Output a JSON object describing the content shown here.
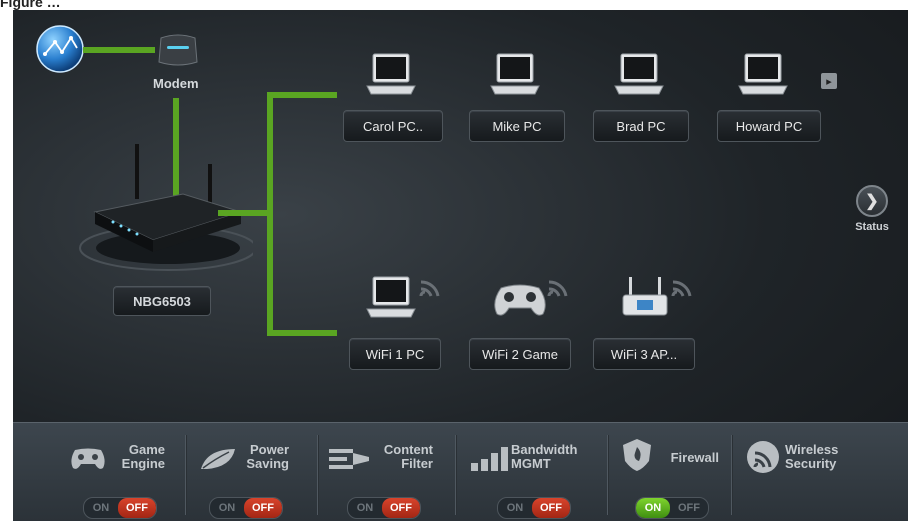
{
  "caption": "Figure …",
  "modem": {
    "label": "Modem"
  },
  "router": {
    "name": "NBG6503"
  },
  "wired_devices": [
    {
      "label": "Carol PC.."
    },
    {
      "label": "Mike PC"
    },
    {
      "label": "Brad PC"
    },
    {
      "label": "Howard PC"
    }
  ],
  "wireless_devices": [
    {
      "label": "WiFi 1 PC",
      "icon": "laptop-icon"
    },
    {
      "label": "WiFi 2 Game",
      "icon": "gamepad-icon"
    },
    {
      "label": "WiFi 3 AP...",
      "icon": "access-point-icon"
    }
  ],
  "status_button": {
    "label": "Status"
  },
  "features": [
    {
      "label_line1": "Game",
      "label_line2": "Engine",
      "icon": "gamepad-icon",
      "on_label": "ON",
      "off_label": "OFF",
      "state": "off"
    },
    {
      "label_line1": "Power",
      "label_line2": "Saving",
      "icon": "leaf-icon",
      "on_label": "ON",
      "off_label": "OFF",
      "state": "off"
    },
    {
      "label_line1": "Content",
      "label_line2": "Filter",
      "icon": "content-filter-icon",
      "on_label": "ON",
      "off_label": "OFF",
      "state": "off"
    },
    {
      "label_line1": "Bandwidth",
      "label_line2": "MGMT",
      "icon": "bandwidth-bars-icon",
      "on_label": "ON",
      "off_label": "OFF",
      "state": "off"
    },
    {
      "label_line1": "Firewall",
      "label_line2": "",
      "icon": "firewall-icon",
      "on_label": "ON",
      "off_label": "OFF",
      "state": "on"
    },
    {
      "label_line1": "Wireless",
      "label_line2": "Security",
      "icon": "wireless-security-icon"
    }
  ],
  "colors": {
    "wire": "#5aa522",
    "toggle_off": "#c0341f",
    "toggle_on": "#5cb021"
  }
}
